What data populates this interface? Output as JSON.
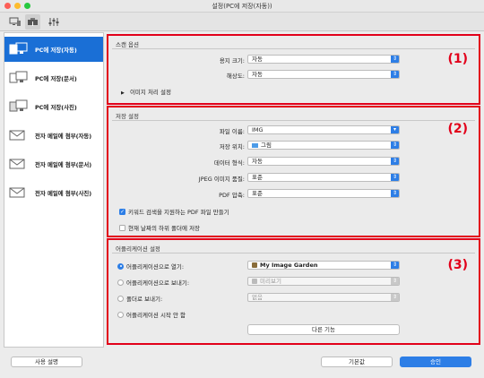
{
  "window": {
    "title": "설정(PC에 저장(자동))"
  },
  "toolbar": {
    "tabs": [
      "scan-from-computer-icon",
      "scan-from-operation-panel-icon",
      "general-settings-icon"
    ]
  },
  "sidebar": {
    "items": [
      {
        "label": "PC에 저장(자동)",
        "icon": "save-pc-auto-icon",
        "selected": true
      },
      {
        "label": "PC에 저장(문서)",
        "icon": "save-pc-document-icon"
      },
      {
        "label": "PC에 저장(사진)",
        "icon": "save-pc-photo-icon"
      },
      {
        "label": "전자 메일에 첨부(자동)",
        "icon": "email-auto-icon"
      },
      {
        "label": "전자 메일에 첨부(문서)",
        "icon": "email-document-icon"
      },
      {
        "label": "전자 메일에 첨부(사진)",
        "icon": "email-photo-icon"
      }
    ]
  },
  "scan_options": {
    "heading": "스캔 옵션",
    "marker": "(1)",
    "paper_size_label": "용지 크기:",
    "paper_size_value": "자동",
    "resolution_label": "해상도:",
    "resolution_value": "자동",
    "image_processing_label": "이미지 처리 설정"
  },
  "save_settings": {
    "heading": "저장 설정",
    "marker": "(2)",
    "file_name_label": "파일 이름:",
    "file_name_value": "IMG",
    "save_in_label": "저장 위치:",
    "save_in_value": "그림",
    "data_format_label": "데이터 형식:",
    "data_format_value": "자동",
    "jpeg_quality_label": "JPEG 이미지 품질:",
    "jpeg_quality_value": "표준",
    "pdf_compression_label": "PDF 압축:",
    "pdf_compression_value": "표준",
    "keyword_pdf_label": "키워드 검색을 지원하는 PDF 파일 만들기",
    "keyword_pdf_checked": true,
    "subfolder_label": "현재 날짜의 하위 폴더에 저장",
    "subfolder_checked": false
  },
  "application_settings": {
    "heading": "어플리케이션 설정",
    "marker": "(3)",
    "open_with_label": "어플리케이션으로 열기:",
    "open_with_value": "My Image Garden",
    "send_to_app_label": "어플리케이션으로 보내기:",
    "send_to_app_value": "미리보기",
    "send_to_folder_label": "폴더로 보내기:",
    "send_to_folder_value": "없음",
    "do_not_start_label": "어플리케이션 시작 안 함",
    "more_functions_label": "다른 기능"
  },
  "footer": {
    "instructions_label": "사용 설명",
    "defaults_label": "기본값",
    "ok_label": "승인"
  },
  "colors": {
    "accent": "#2d7ee6",
    "highlight": "#e2001a",
    "selected": "#1a6fd6"
  }
}
